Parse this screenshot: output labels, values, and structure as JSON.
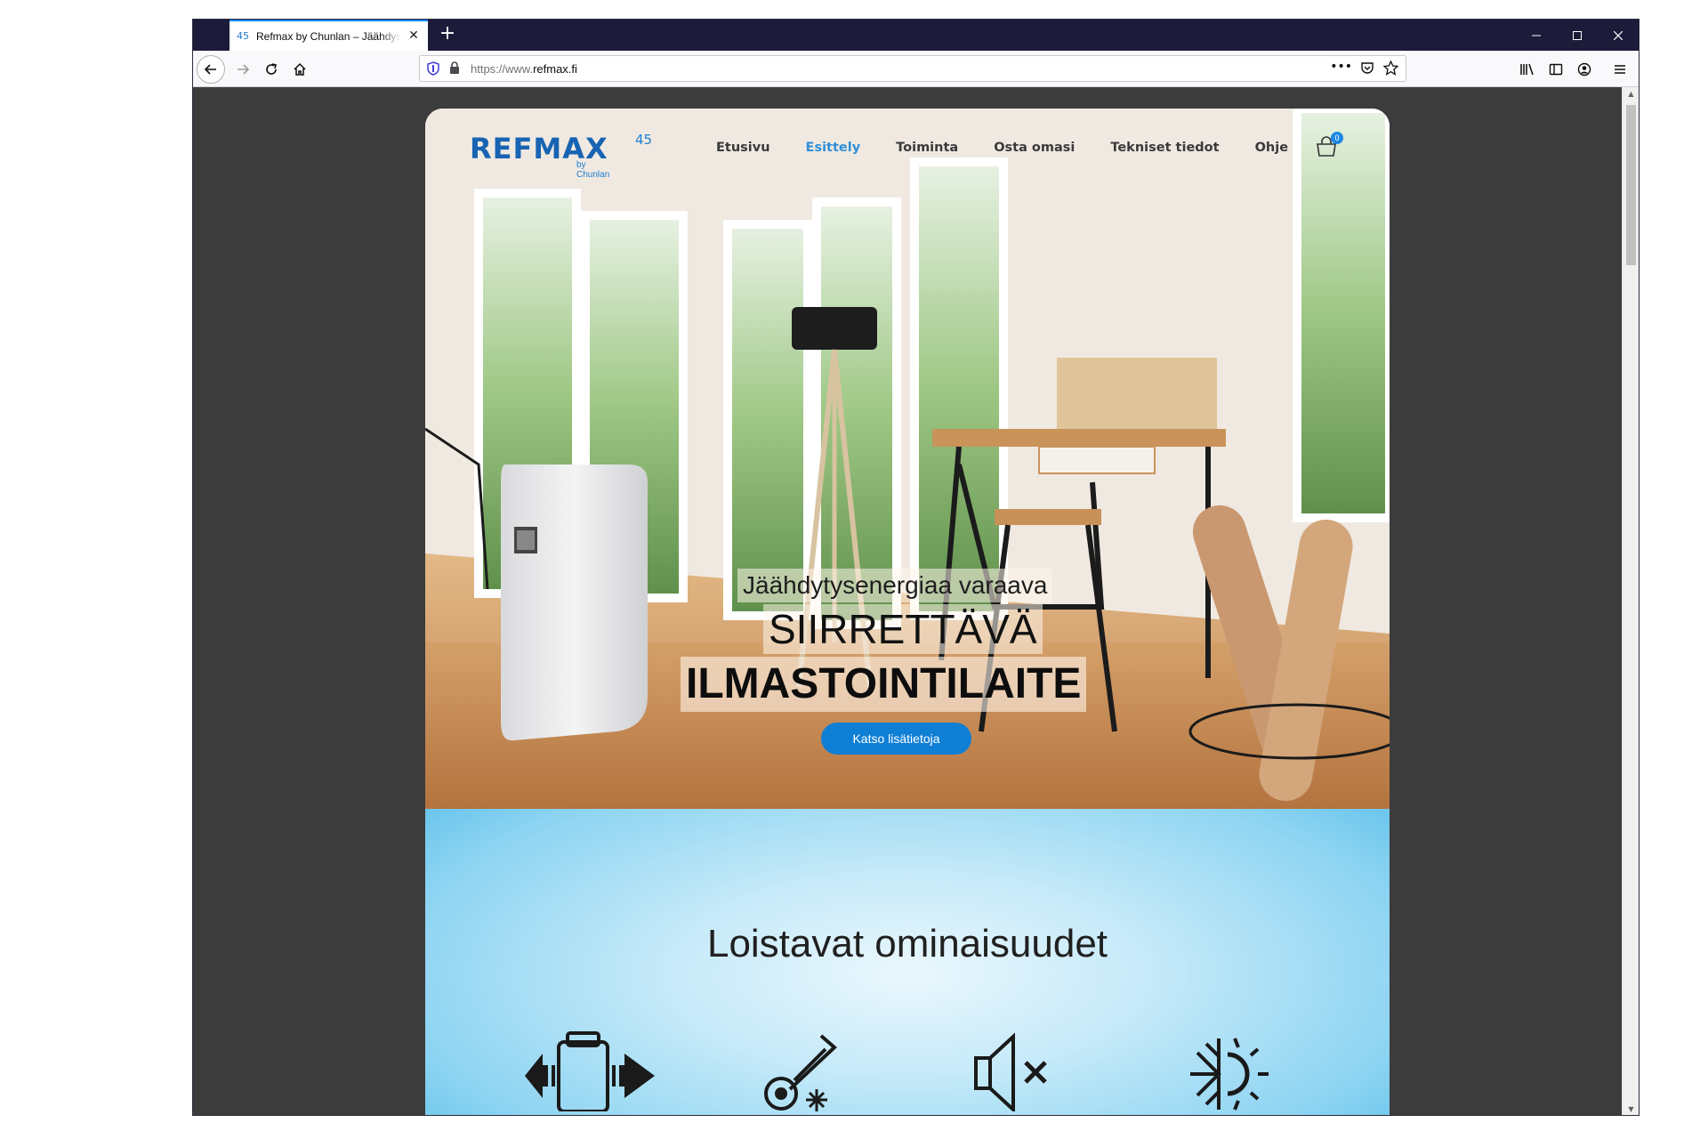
{
  "browser": {
    "tab_title": "Refmax by Chunlan – Jäähdystysenergiaa",
    "tab_favicon": "45",
    "url_prefix": "https://www.",
    "url_domain": "refmax.fi",
    "icons": [
      "back-arrow-icon",
      "forward-arrow-icon",
      "reload-icon",
      "home-icon",
      "shield-icon",
      "lock-icon",
      "more-icon",
      "pocket-icon",
      "bookmark-star-icon",
      "library-icon",
      "sidebar-icon",
      "account-icon",
      "menu-icon"
    ]
  },
  "site": {
    "logo_text": "REFMAX",
    "logo_number": "45",
    "logo_sub": "by Chunlan",
    "nav": [
      {
        "label": "Etusivu",
        "active": false
      },
      {
        "label": "Esittely",
        "active": true
      },
      {
        "label": "Toiminta",
        "active": false
      },
      {
        "label": "Osta omasi",
        "active": false
      },
      {
        "label": "Tekniset tiedot",
        "active": false
      },
      {
        "label": "Ohje",
        "active": false
      }
    ],
    "cart_count": "0",
    "accent": "#2f8fd8"
  },
  "hero": {
    "line1": "Jäähdytysenergiaa varaava",
    "line2": "SIIRRETTÄVÄ",
    "line3": "ILMASTOINTILAITE",
    "button": "Katso lisätietoja"
  },
  "features": {
    "title": "Loistavat ominaisuudet",
    "icons": [
      "portable-unit-icon",
      "thermometer-cold-icon",
      "silent-speaker-icon",
      "snow-sun-icon"
    ]
  }
}
